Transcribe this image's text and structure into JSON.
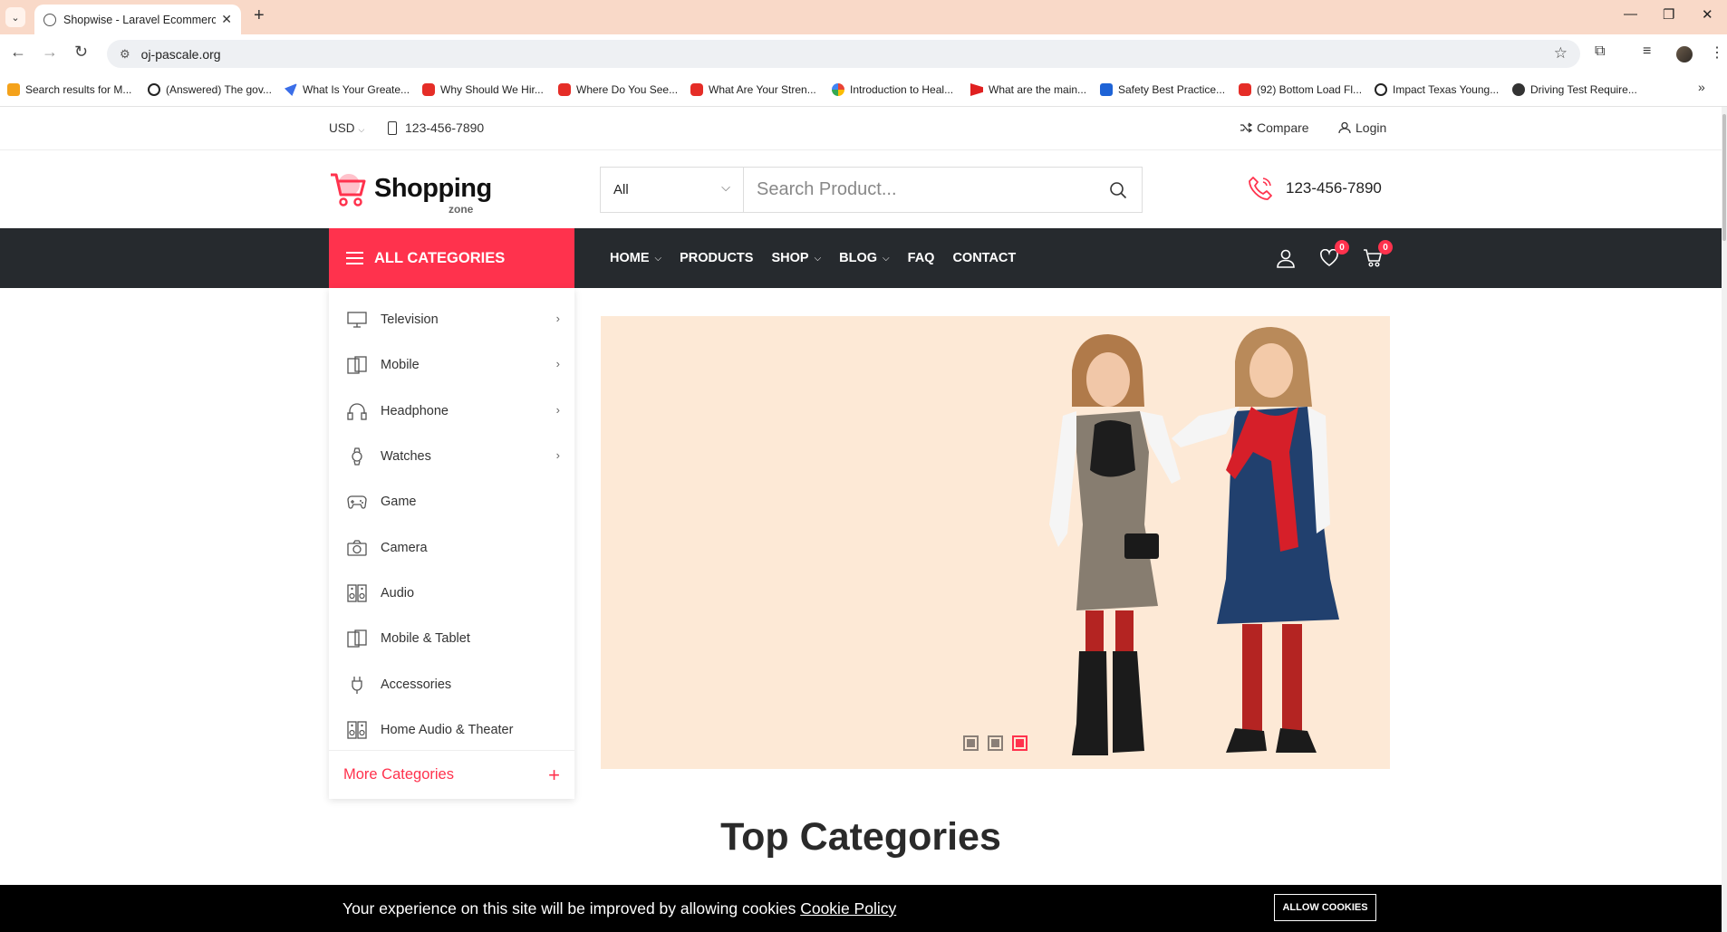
{
  "browser": {
    "tab_title": "Shopwise - Laravel Ecommerce",
    "url": "oj-pascale.org",
    "bookmarks": [
      {
        "label": "Search results for M...",
        "icon": "s"
      },
      {
        "label": "(Answered) The gov...",
        "icon": "chat"
      },
      {
        "label": "What Is Your Greate...",
        "icon": "bird"
      },
      {
        "label": "Why Should We Hir...",
        "icon": "yt"
      },
      {
        "label": "Where Do You See...",
        "icon": "yt"
      },
      {
        "label": "What Are Your Stren...",
        "icon": "yt"
      },
      {
        "label": "Introduction to Heal...",
        "icon": "g"
      },
      {
        "label": "What are the main...",
        "icon": "red"
      },
      {
        "label": "Safety Best Practice...",
        "icon": "blue"
      },
      {
        "label": "(92) Bottom Load Fl...",
        "icon": "yt"
      },
      {
        "label": "Impact Texas Young...",
        "icon": "chat"
      },
      {
        "label": "Driving Test Require...",
        "icon": "dark"
      }
    ]
  },
  "topbar": {
    "currency": "USD",
    "phone": "123-456-7890",
    "compare": "Compare",
    "login": "Login"
  },
  "header": {
    "logo_text": "Shopping",
    "logo_sub": "zone",
    "search_category": "All",
    "search_placeholder": "Search Product...",
    "phone": "123-456-7890"
  },
  "nav": {
    "all_categories": "ALL CATEGORIES",
    "items": [
      {
        "label": "HOME",
        "dropdown": true
      },
      {
        "label": "PRODUCTS",
        "dropdown": false
      },
      {
        "label": "SHOP",
        "dropdown": true
      },
      {
        "label": "BLOG",
        "dropdown": true
      },
      {
        "label": "FAQ",
        "dropdown": false
      },
      {
        "label": "CONTACT",
        "dropdown": false
      }
    ],
    "wishlist_count": "0",
    "cart_count": "0"
  },
  "categories": {
    "items": [
      {
        "label": "Television",
        "icon": "tv",
        "submenu": true
      },
      {
        "label": "Mobile",
        "icon": "mobile",
        "submenu": true
      },
      {
        "label": "Headphone",
        "icon": "headphone",
        "submenu": true
      },
      {
        "label": "Watches",
        "icon": "watch",
        "submenu": true
      },
      {
        "label": "Game",
        "icon": "gamepad",
        "submenu": false
      },
      {
        "label": "Camera",
        "icon": "camera",
        "submenu": false
      },
      {
        "label": "Audio",
        "icon": "speaker",
        "submenu": false
      },
      {
        "label": "Mobile & Tablet",
        "icon": "mobile",
        "submenu": false
      },
      {
        "label": "Accessories",
        "icon": "plug",
        "submenu": false
      },
      {
        "label": "Home Audio & Theater",
        "icon": "speaker",
        "submenu": false
      }
    ],
    "more": "More Categories"
  },
  "banner": {
    "active_slide": 3,
    "slide_count": 3
  },
  "section": {
    "title": "Top Categories"
  },
  "cookie": {
    "message": "Your experience on this site will be improved by allowing cookies",
    "link": "Cookie Policy",
    "button": "ALLOW COOKIES"
  },
  "colors": {
    "accent": "#ff324d",
    "nav_bg": "#262a2e",
    "banner_bg": "#fde9d6"
  }
}
